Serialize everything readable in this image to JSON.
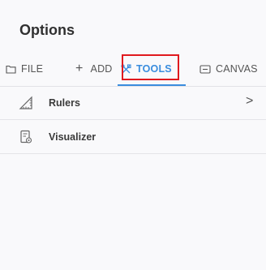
{
  "panel": {
    "title": "Options"
  },
  "tabs": [
    {
      "label": "FILE",
      "icon": "folder-icon"
    },
    {
      "label": "ADD",
      "icon": "plus-icon",
      "icon_glyph": "+"
    },
    {
      "label": "TOOLS",
      "icon": "tools-icon",
      "selected": true
    },
    {
      "label": "CANVAS",
      "icon": "canvas-icon"
    }
  ],
  "list": [
    {
      "label": "Rulers",
      "icon": "ruler-icon",
      "chevron": ">"
    },
    {
      "label": "Visualizer",
      "icon": "visualizer-icon"
    }
  ],
  "colors": {
    "accent": "#3a8dde",
    "highlight": "#e0191e"
  }
}
